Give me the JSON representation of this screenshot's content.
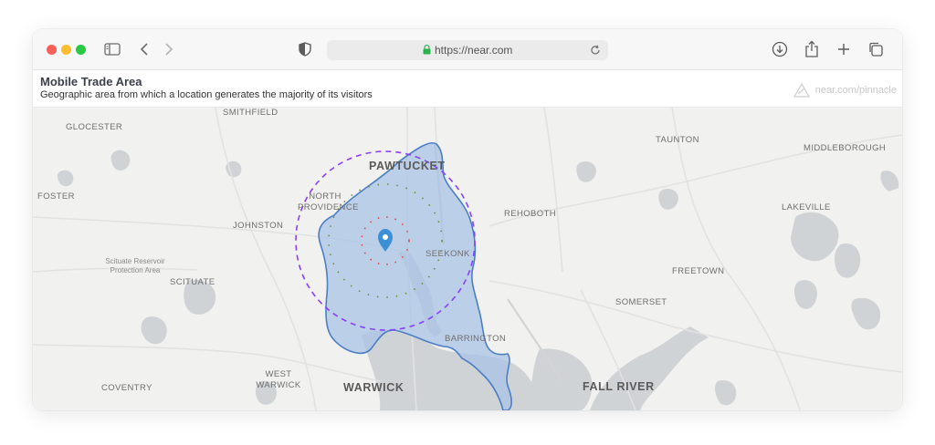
{
  "browser": {
    "url": "https://near.com",
    "colors": {
      "red": "#fe5f57",
      "yellow": "#febc2e",
      "green": "#28c840"
    },
    "icons": [
      "sidebar-icon",
      "back-icon",
      "forward-icon",
      "shield-icon",
      "lock-icon",
      "reload-icon",
      "download-icon",
      "share-icon",
      "new-tab-icon",
      "tabs-overview-icon"
    ]
  },
  "header": {
    "title": "Mobile Trade Area",
    "subtitle": "Geographic area from which a location generates the majority of its visitors",
    "brand": "near.com/pinnacle"
  },
  "map": {
    "labels": {
      "smithfield": "SMITHFIELD",
      "glocester": "GLOCESTER",
      "foster": "FOSTER",
      "johnston": "JOHNSTON",
      "scituate_reservoir": "Scituate Reservoir Protection Area",
      "scituate": "SCITUATE",
      "coventry": "COVENTRY",
      "west_warwick": "WEST WARWICK",
      "warwick": "WARWICK",
      "pawtucket": "PAWTUCKET",
      "north_providence": "NORTH PROVIDENCE",
      "seekonk": "SEEKONK",
      "rehoboth": "REHOBOTH",
      "barrington": "BARRINGTON",
      "taunton": "TAUNTON",
      "middleborough": "MIDDLEBOROUGH",
      "lakeville": "LAKEVILLE",
      "freetown": "FREETOWN",
      "somerset": "SOMERSET",
      "fall_river": "FALL RIVER"
    },
    "colors": {
      "land": "#f1f1f0",
      "water": "#cfd3d6",
      "trade_area_fill": "#a9c3e6",
      "trade_area_stroke": "#4a7fc4",
      "outer_ring": "#8a3ffc",
      "pin": "#3d8fd6"
    }
  }
}
